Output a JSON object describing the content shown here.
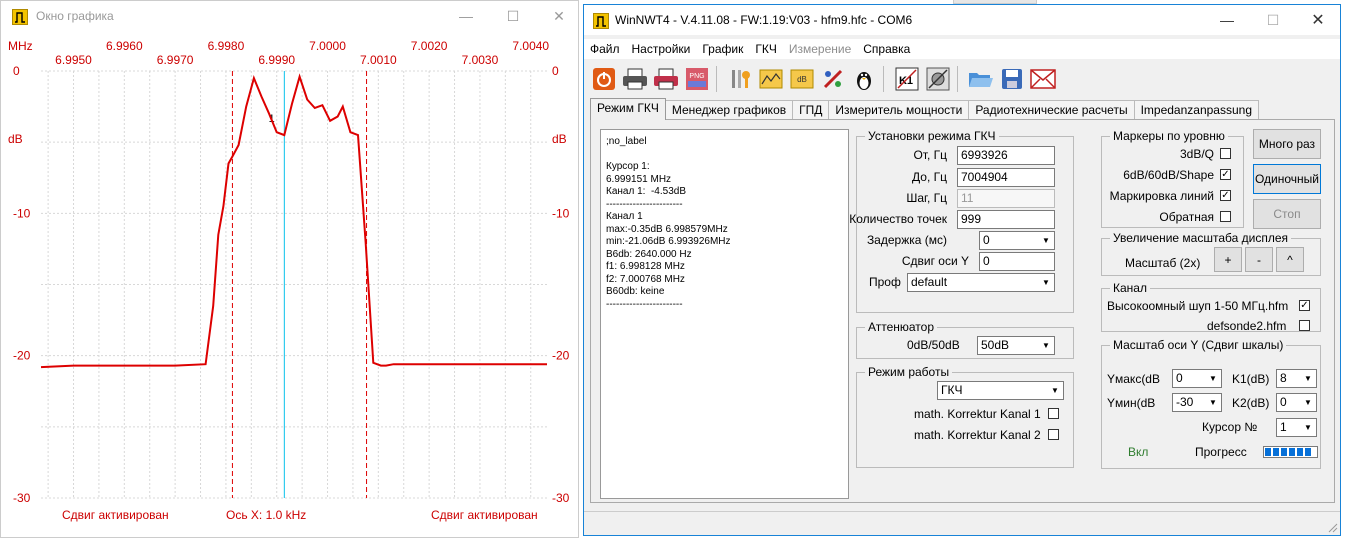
{
  "graph_window": {
    "title": "Окно графика",
    "y_unit_left": "MHz",
    "y_unit_right": "",
    "db_label": "dB",
    "top_ticks": [
      "6.9960",
      "6.9980",
      "7.0000",
      "7.0020",
      "7.0040"
    ],
    "bottom_ticks": [
      "6.9950",
      "6.9970",
      "6.9990",
      "7.0010",
      "7.0030"
    ],
    "y_ticks_left": [
      "0",
      "-10",
      "-20",
      "-30"
    ],
    "y_ticks_right": [
      "0",
      "-10",
      "-20",
      "-30"
    ],
    "status_left": "Сдвиг активирован",
    "status_center": "Ось X: 1.0 kHz",
    "status_right": "Сдвиг активирован",
    "cursor_marker": "1",
    "colors": {
      "trace": "#dd0000",
      "cursor": "#33ccee",
      "grid": "#d8d8d8",
      "labels": "#cc0000"
    }
  },
  "chart_data": {
    "type": "line",
    "title": "",
    "xlabel": "Ось X: 1.0 kHz",
    "ylabel": "dB",
    "xlim": [
      6.99436,
      7.00432
    ],
    "ylim": [
      -30,
      0
    ],
    "x_ticks_top": [
      6.996,
      6.998,
      7.0,
      7.002,
      7.004
    ],
    "x_ticks_bottom": [
      6.995,
      6.997,
      6.999,
      7.001,
      7.003
    ],
    "y_ticks": [
      0,
      -10,
      -20,
      -30
    ],
    "grid": true,
    "series": [
      {
        "x": [
          6.99389,
          6.995,
          6.996,
          6.997,
          6.9976,
          6.99775,
          6.99785,
          6.99795,
          6.99805,
          6.99813,
          6.99825,
          6.9984,
          6.99855,
          6.9987,
          6.99885,
          6.999,
          6.99915,
          6.9993,
          6.99945,
          6.9996,
          6.99975,
          6.9999,
          7.00005,
          7.0002,
          7.0003,
          7.00045,
          7.0006,
          7.00075,
          7.0009,
          7.00105,
          7.00115,
          7.0013,
          7.002,
          7.003,
          7.004,
          7.0049
        ],
        "values": [
          -20.8,
          -20.7,
          -20.7,
          -20.7,
          -20.6,
          -16.5,
          -11.5,
          -9.5,
          -6.5,
          -6.0,
          -5.2,
          -2.5,
          -0.5,
          -1.8,
          -3.0,
          -4.3,
          -4.5,
          -2.3,
          -0.4,
          -2.0,
          -2.6,
          -2.4,
          -3.5,
          -3.2,
          -2.5,
          -4.3,
          -4.5,
          -12.0,
          -20.5,
          -20.7,
          -20.7,
          -20.6,
          -20.6,
          -20.6,
          -20.6,
          -20.6
        ]
      }
    ],
    "markers": {
      "start": 6.998128,
      "end": 7.000768,
      "cursor": 6.999151,
      "cursor_level": -4.53,
      "cursor_label": "1"
    }
  },
  "main_window": {
    "title": "WinNWT4 - V.4.11.08 - FW:1.19:V03 - hfm9.hfc - COM6",
    "menu": [
      {
        "label": "Файл",
        "disabled": false
      },
      {
        "label": "Настройки",
        "disabled": false
      },
      {
        "label": "График",
        "disabled": false
      },
      {
        "label": "ГКЧ",
        "disabled": false
      },
      {
        "label": "Измерение",
        "disabled": true
      },
      {
        "label": "Справка",
        "disabled": false
      }
    ],
    "toolbar_icons": [
      "power-icon",
      "printer-icon",
      "print-color-icon",
      "png-export-icon",
      "tools-icon",
      "folder-chart-icon",
      "db-chart-icon",
      "calibrate-icon",
      "penguin-icon",
      "k1-icon",
      "screenshot-icon",
      "open-folder-icon",
      "save-icon",
      "mail-icon"
    ],
    "toolbar_text": {
      "png": "PNG",
      "db": "dB",
      "k1": "K1"
    },
    "tabs": [
      "Режим ГКЧ",
      "Менеджер графиков",
      "ГПД",
      "Измеритель мощности",
      "Радиотехнические расчеты",
      "Impedanzanpassung"
    ],
    "active_tab": 0,
    "info_text": ";no_label\n\nКурсор 1:\n6.999151 MHz\nКанал 1:  -4.53dB\n-----------------------\nКанал 1\nmax:-0.35dB 6.998579MHz\nmin:-21.06dB 6.993926MHz\nB6db: 2640.000 Hz\nf1: 6.998128 MHz\nf2: 7.000768 MHz\nB60db: keine\n-----------------------",
    "sweep": {
      "group_label": "Установки режима ГКЧ",
      "from_label": "От, Гц",
      "from_value": "6993926",
      "to_label": "До, Гц",
      "to_value": "7004904",
      "step_label": "Шаг, Гц",
      "step_value": "11",
      "points_label": "Количество точек",
      "points_value": "999",
      "delay_label": "Задержка (мс)",
      "delay_value": "0",
      "yshift_label": "Сдвиг оси Y",
      "yshift_value": "0",
      "profile_label": "Проф",
      "profile_value": "default"
    },
    "attenuator": {
      "group_label": "Аттенюатор",
      "label": "0dB/50dB",
      "value": "50dB"
    },
    "mode": {
      "group_label": "Режим работы",
      "value": "ГКЧ",
      "k1_label": "math. Korrektur Kanal 1",
      "k2_label": "math. Korrektur Kanal 2"
    },
    "markers": {
      "group_label": "Маркеры по уровню",
      "q_label": "3dB/Q",
      "shape_label": "6dB/60dB/Shape",
      "lines_label": "Маркировка линий",
      "reverse_label": "Обратная"
    },
    "buttons": {
      "multi": "Много раз",
      "single": "Одиночный",
      "stop": "Стоп"
    },
    "zoom": {
      "group_label": "Увеличение масштаба дисплея",
      "label": "Масштаб (2x)",
      "plus": "+",
      "minus": "-",
      "up": "^"
    },
    "channel": {
      "group_label": "Канал",
      "probe1": "Высокоомный шуп 1-50 МГц.hfm",
      "probe2": "defsonde2.hfm"
    },
    "yscale": {
      "group_label": "Масштаб оси Y (Сдвиг шкалы)",
      "ymax_label": "Yмакс(dB",
      "ymax_value": "0",
      "ymin_label": "Yмин(dB",
      "ymin_value": "-30",
      "k1_label": "K1(dB)",
      "k1_value": "8",
      "k2_label": "K2(dB)",
      "k2_value": "0",
      "cursor_label": "Курсор №",
      "cursor_value": "1",
      "on_label": "Вкл",
      "progress_label": "Прогресс"
    },
    "colors": {
      "on_label": "#2f7d2f",
      "progress": "#0670d8",
      "title_icon": "#e8b800"
    }
  }
}
